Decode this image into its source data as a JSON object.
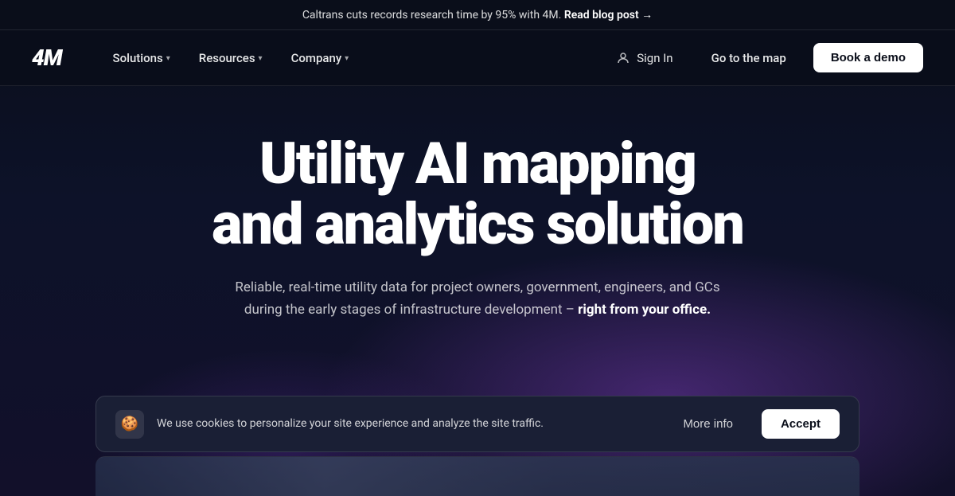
{
  "announcement": {
    "text": "Caltrans cuts records research time by 95% with 4M.",
    "link_text": "Read blog post →",
    "link_href": "#"
  },
  "nav": {
    "logo": "4M",
    "items": [
      {
        "label": "Solutions",
        "has_dropdown": true
      },
      {
        "label": "Resources",
        "has_dropdown": true
      },
      {
        "label": "Company",
        "has_dropdown": true
      }
    ],
    "sign_in_label": "Sign In",
    "go_to_map_label": "Go to the map",
    "book_demo_label": "Book a demo"
  },
  "hero": {
    "title_line1": "Utility AI mapping",
    "title_line2": "and analytics solution",
    "subtitle_normal": "Reliable, real-time utility data for project owners, government, engineers, and GCs during the early stages of infrastructure development –",
    "subtitle_bold": " right from your office."
  },
  "cookie": {
    "icon": "🍪",
    "text": "We use cookies to personalize your site experience and analyze the site traffic.",
    "more_info_label": "More info",
    "accept_label": "Accept"
  }
}
